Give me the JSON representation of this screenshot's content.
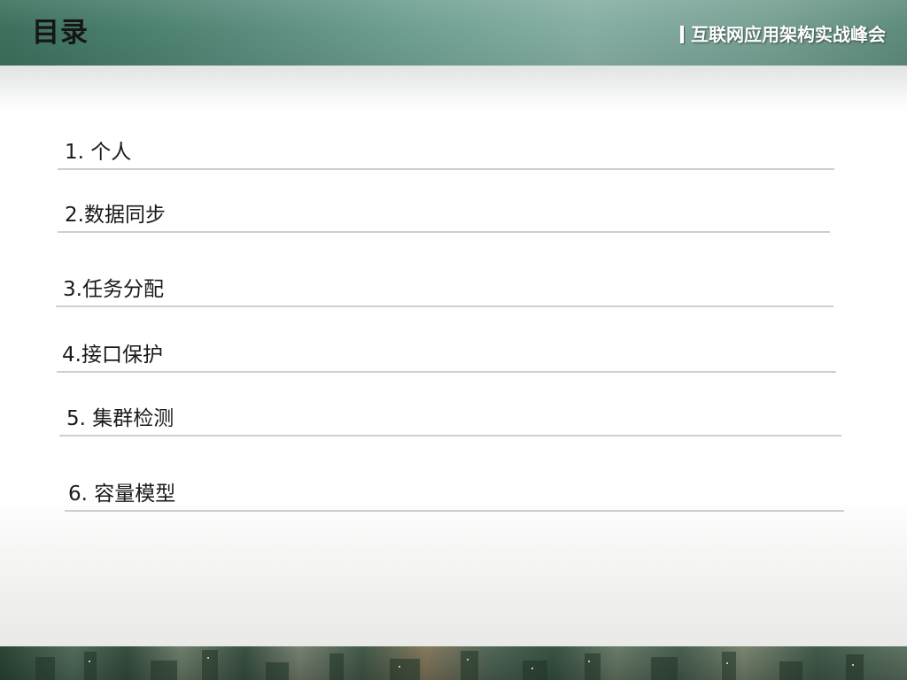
{
  "header": {
    "title": "目录",
    "conference": "互联网应用架构实战峰会"
  },
  "toc": [
    {
      "label": "1. 个人"
    },
    {
      "label": "2.数据同步"
    },
    {
      "label": "3.任务分配"
    },
    {
      "label": "4.接口保护"
    },
    {
      "label": "5. 集群检测"
    },
    {
      "label": "6. 容量模型"
    }
  ],
  "theme": {
    "header_color": "#5f9585",
    "rule_color": "#cfcfcf",
    "text_color": "#1a1a1a"
  }
}
